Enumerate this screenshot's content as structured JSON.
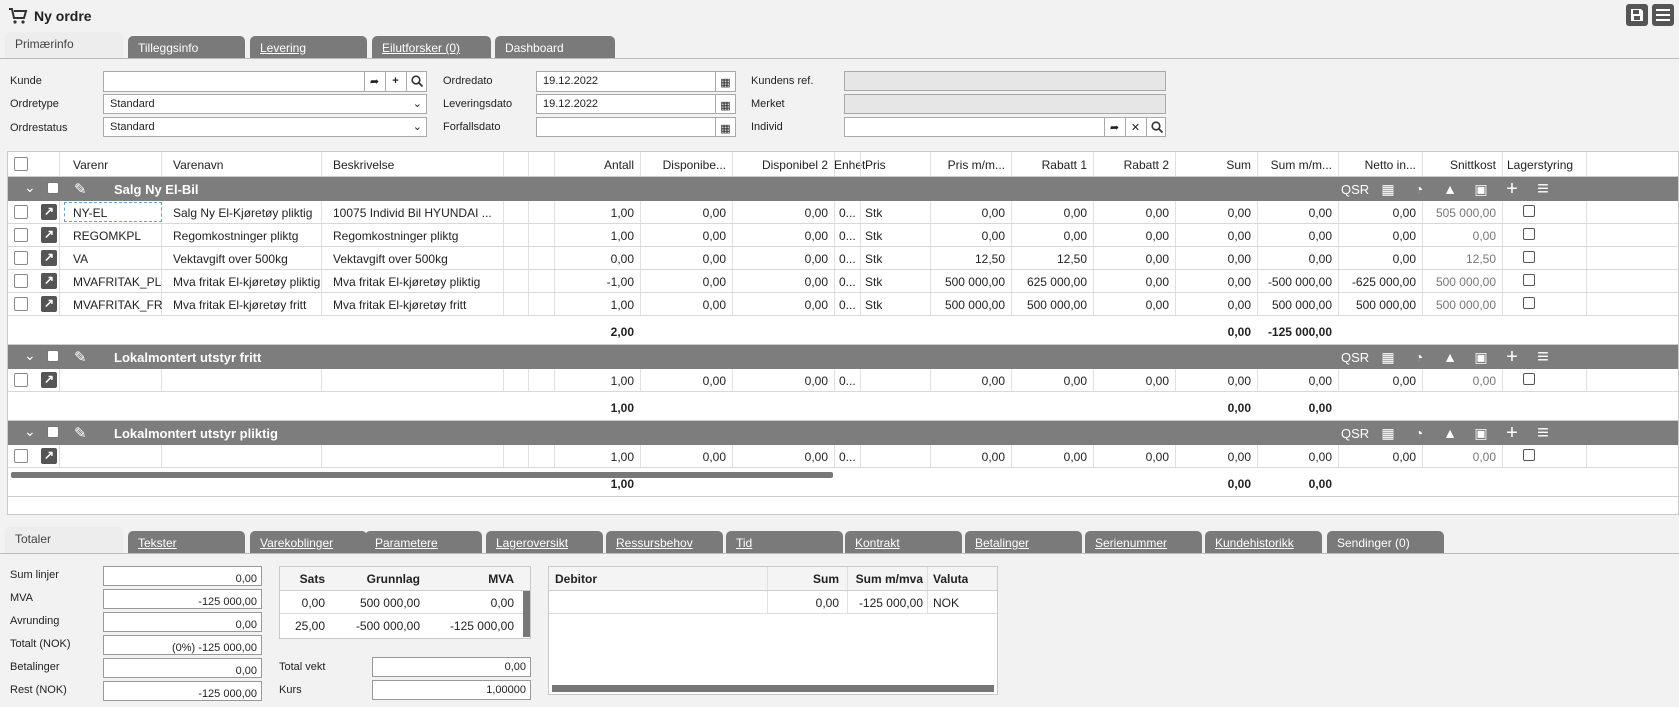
{
  "header": {
    "title": "Ny ordre"
  },
  "tabs": [
    {
      "label": "Primærinfo"
    },
    {
      "label": "Tilleggsinfo"
    },
    {
      "label": "Levering"
    },
    {
      "label": "Eilutforsker (0)"
    },
    {
      "label": "Dashboard"
    }
  ],
  "form": {
    "kunde": {
      "label": "Kunde",
      "value": ""
    },
    "ordretype": {
      "label": "Ordretype",
      "value": "Standard"
    },
    "ordrestatus": {
      "label": "Ordrestatus",
      "value": "Standard"
    },
    "ordredato": {
      "label": "Ordredato",
      "value": "19.12.2022"
    },
    "leveringsdato": {
      "label": "Leveringsdato",
      "value": "19.12.2022"
    },
    "forfallsdato": {
      "label": "Forfallsdato",
      "value": ""
    },
    "kundens_ref": {
      "label": "Kundens ref.",
      "value": ""
    },
    "merket": {
      "label": "Merket",
      "value": ""
    },
    "individ": {
      "label": "Individ",
      "value": ""
    }
  },
  "grid": {
    "columns": [
      "Varenr",
      "Varenavn",
      "Beskrivelse",
      "Antall",
      "Disponibe...",
      "Disponibel 2",
      "Enhet",
      "Pris",
      "Pris m/m...",
      "Rabatt 1",
      "Rabatt 2",
      "Sum",
      "Sum m/m...",
      "Netto in...",
      "Snittkost",
      "Lagerstyring"
    ],
    "group_tools": "QSR",
    "groups": [
      {
        "name": "Salg Ny El-Bil",
        "rows": [
          [
            "NY-EL",
            "Salg Ny El-Kjøretøy pliktig",
            "10075 Individ Bil HYUNDAI ...",
            "1,00",
            "0,00",
            "0,00",
            "0...",
            "Stk",
            "0,00",
            "0,00",
            "0,00",
            "0,00",
            "0,00",
            "0,00",
            "505 000,00",
            "505 000,00"
          ],
          [
            "REGOMKPL",
            "Regomkostninger pliktg",
            "Regomkostninger pliktg",
            "1,00",
            "0,00",
            "0,00",
            "0...",
            "Stk",
            "0,00",
            "0,00",
            "0,00",
            "0,00",
            "0,00",
            "0,00",
            "0,00",
            "0,00"
          ],
          [
            "VA",
            "Vektavgift over 500kg",
            "Vektavgift over 500kg",
            "0,00",
            "0,00",
            "0,00",
            "0...",
            "Stk",
            "12,50",
            "12,50",
            "0,00",
            "0,00",
            "0,00",
            "0,00",
            "12,50",
            "12,50"
          ],
          [
            "MVAFRITAK_PL",
            "Mva fritak El-kjøretøy pliktig",
            "Mva fritak El-kjøretøy pliktig",
            "-1,00",
            "0,00",
            "0,00",
            "0...",
            "Stk",
            "500 000,00",
            "625 000,00",
            "0,00",
            "0,00",
            "-500 000,00",
            "-625 000,00",
            "500 000,00",
            "500 000,00"
          ],
          [
            "MVAFRITAK_FR",
            "Mva fritak El-kjøretøy fritt",
            "Mva fritak El-kjøretøy fritt",
            "1,00",
            "0,00",
            "0,00",
            "0...",
            "Stk",
            "500 000,00",
            "500 000,00",
            "0,00",
            "0,00",
            "500 000,00",
            "500 000,00",
            "500 000,00",
            "500 000,00"
          ]
        ],
        "total": {
          "antall": "2,00",
          "sum": "0,00",
          "sum_mm": "-125 000,00"
        }
      },
      {
        "name": "Lokalmontert utstyr fritt",
        "rows": [
          [
            "",
            "",
            "",
            "1,00",
            "0,00",
            "0,00",
            "0...",
            "",
            "0,00",
            "0,00",
            "0,00",
            "0,00",
            "0,00",
            "0,00",
            "0,00",
            "0,00"
          ]
        ],
        "total": {
          "antall": "1,00",
          "sum": "0,00",
          "sum_mm": "0,00"
        }
      },
      {
        "name": "Lokalmontert utstyr pliktig",
        "rows": [
          [
            "",
            "",
            "",
            "1,00",
            "0,00",
            "0,00",
            "0...",
            "",
            "0,00",
            "0,00",
            "0,00",
            "0,00",
            "0,00",
            "0,00",
            "0,00",
            "0,00"
          ]
        ],
        "total": {
          "antall": "1,00",
          "sum": "0,00",
          "sum_mm": "0,00"
        }
      }
    ]
  },
  "bottom_tabs": [
    {
      "label": "Totaler"
    },
    {
      "label": "Tekster"
    },
    {
      "label": "Varekoblinger"
    },
    {
      "label": "Parametere"
    },
    {
      "label": "Lageroversikt"
    },
    {
      "label": "Ressursbehov"
    },
    {
      "label": "Tid"
    },
    {
      "label": "Kontrakt"
    },
    {
      "label": "Betalinger"
    },
    {
      "label": "Serienummer"
    },
    {
      "label": "Kundehistorikk"
    },
    {
      "label": "Sendinger (0)"
    }
  ],
  "totals": {
    "sum_linjer": {
      "label": "Sum linjer",
      "value": "0,00"
    },
    "mva": {
      "label": "MVA",
      "value": "-125 000,00"
    },
    "avrunding": {
      "label": "Avrunding",
      "value": "0,00"
    },
    "totalt": {
      "label": "Totalt (NOK)",
      "value": "(0%) -125 000,00"
    },
    "betalinger": {
      "label": "Betalinger",
      "value": "0,00"
    },
    "rest": {
      "label": "Rest (NOK)",
      "value": "-125 000,00"
    }
  },
  "mva_table": {
    "headers": [
      "Sats",
      "Grunnlag",
      "MVA"
    ],
    "rows": [
      [
        "0,00",
        "500 000,00",
        "0,00"
      ],
      [
        "25,00",
        "-500 000,00",
        "-125 000,00"
      ]
    ]
  },
  "weight": {
    "total_vekt": {
      "label": "Total vekt",
      "value": "0,00"
    },
    "kurs": {
      "label": "Kurs",
      "value": "1,00000"
    }
  },
  "debitor_table": {
    "headers": [
      "Debitor",
      "Sum",
      "Sum m/mva",
      "Valuta"
    ],
    "rows": [
      [
        "",
        "0,00",
        "-125 000,00",
        "NOK"
      ]
    ]
  }
}
